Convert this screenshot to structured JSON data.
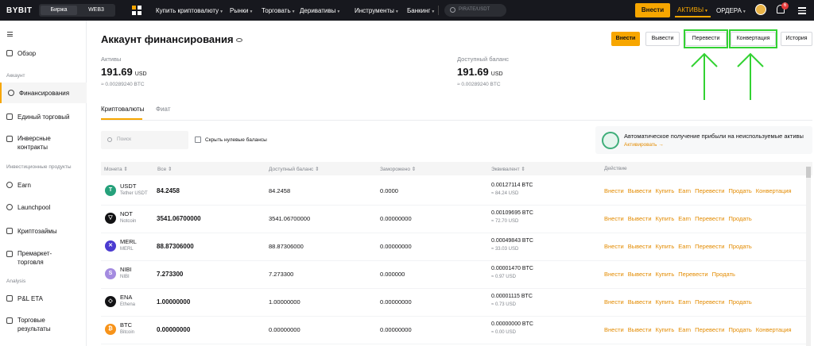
{
  "topbar": {
    "logo": "BYBIT",
    "segment": [
      "Биржа",
      "WEB3"
    ],
    "nav": [
      "Купить криптовалюту",
      "Рынки",
      "Торговать",
      "Деривативы",
      "Инструменты",
      "Банкинг"
    ],
    "search_placeholder": "PIRATE/USDT",
    "deposit": "Внести",
    "assets": "АКТИВЫ",
    "orders": "ОРДЕРА",
    "notif_count": "6",
    "accent": "#f7a600"
  },
  "sidebar": {
    "items": [
      {
        "label": "Обзор"
      },
      {
        "label": "Финансирования"
      },
      {
        "label": "Единый торговый"
      },
      {
        "label": "Инверсные контракты"
      },
      {
        "label": "Earn"
      },
      {
        "label": "Launchpool"
      },
      {
        "label": "Криптозаймы"
      },
      {
        "label": "Премаркет-торговля"
      },
      {
        "label": "P&L ETA"
      },
      {
        "label": "Торговые результаты"
      }
    ],
    "headings": [
      "Аккаунт",
      "Инвестиционные продукты",
      "Analysis"
    ]
  },
  "page": {
    "title": "Аккаунт финансирования",
    "buttons": [
      "Внести",
      "Вывести",
      "Перевести",
      "Конвертация",
      "История"
    ],
    "assets_label": "Активы",
    "assets_value": "191.69",
    "assets_unit": "USD",
    "assets_btc": "≈ 0.00289240 BTC",
    "avail_label": "Доступный баланс",
    "avail_value": "191.69",
    "avail_unit": "USD",
    "avail_btc": "≈ 0.00289240 BTC",
    "tabs": [
      "Криптовалюты",
      "Фиат"
    ],
    "search_placeholder": "Поиск",
    "hide_zero": "Скрыть нулевые балансы",
    "promo_text": "Автоматическое получение прибыли на неиспользуемые активы",
    "promo_link": "Активировать →"
  },
  "table": {
    "headers": [
      "Монета",
      "Все",
      "Доступный баланс",
      "Заморожено",
      "Эквивалент",
      "Действие"
    ],
    "rows": [
      {
        "sym": "USDT",
        "name": "Tether USDT",
        "icon_color": "#26a17b",
        "icon": "T",
        "all": "84.2458",
        "avail": "84.2458",
        "frozen": "0.0000",
        "btc": "0.00127114 BTC",
        "usd": "≈ 84.24 USD",
        "actions": [
          "Внести",
          "Вывести",
          "Купить",
          "Earn",
          "Перевести",
          "Продать",
          "Конвертация"
        ]
      },
      {
        "sym": "NOT",
        "name": "Notcoin",
        "icon_color": "#121214",
        "icon": "▽",
        "all": "3541.06700000",
        "avail": "3541.06700000",
        "frozen": "0.00000000",
        "btc": "0.00109695 BTC",
        "usd": "≈ 72.70 USD",
        "actions": [
          "Внести",
          "Вывести",
          "Купить",
          "Earn",
          "Перевести",
          "Продать"
        ]
      },
      {
        "sym": "MERL",
        "name": "MERL",
        "icon_color": "#4b3bd0",
        "icon": "✕",
        "all": "88.87306000",
        "avail": "88.87306000",
        "frozen": "0.00000000",
        "btc": "0.00049843 BTC",
        "usd": "≈ 33.03 USD",
        "actions": [
          "Внести",
          "Вывести",
          "Купить",
          "Earn",
          "Перевести",
          "Продать"
        ]
      },
      {
        "sym": "NIBI",
        "name": "NIBI",
        "icon_color": "#a48be0",
        "icon": "S",
        "all": "7.273300",
        "avail": "7.273300",
        "frozen": "0.000000",
        "btc": "0.00001470 BTC",
        "usd": "≈ 0.97 USD",
        "actions": [
          "Внести",
          "Вывести",
          "Купить",
          "Перевести",
          "Продать"
        ]
      },
      {
        "sym": "ENA",
        "name": "Ethena",
        "icon_color": "#121214",
        "icon": "◇",
        "all": "1.00000000",
        "avail": "1.00000000",
        "frozen": "0.00000000",
        "btc": "0.00001115 BTC",
        "usd": "≈ 0.73 USD",
        "actions": [
          "Внести",
          "Вывести",
          "Купить",
          "Earn",
          "Перевести",
          "Продать"
        ]
      },
      {
        "sym": "BTC",
        "name": "Bitcoin",
        "icon_color": "#f7931a",
        "icon": "₿",
        "all": "0.00000000",
        "avail": "0.00000000",
        "frozen": "0.00000000",
        "btc": "0.00000000 BTC",
        "usd": "≈ 0.00 USD",
        "actions": [
          "Внести",
          "Вывести",
          "Купить",
          "Earn",
          "Перевести",
          "Продать",
          "Конвертация"
        ]
      }
    ]
  }
}
